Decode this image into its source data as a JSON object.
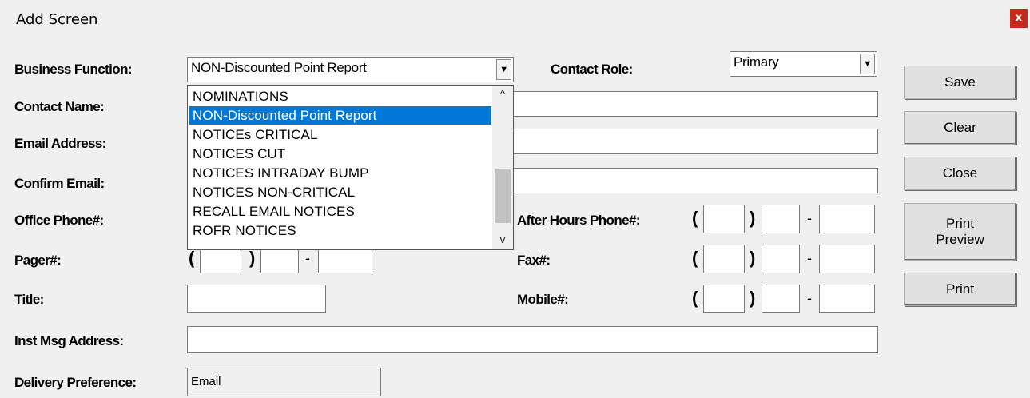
{
  "window": {
    "title": "Add Screen",
    "close_glyph": "x"
  },
  "labels": {
    "business_function": "Business Function:",
    "contact_name": "Contact Name:",
    "email_address": "Email Address:",
    "confirm_email": "Confirm Email:",
    "office_phone": "Office Phone#:",
    "pager": "Pager#:",
    "title": "Title:",
    "inst_msg": "Inst Msg Address:",
    "delivery_pref": "Delivery Preference:",
    "contact_role": "Contact Role:",
    "after_hours": "After Hours Phone#:",
    "fax": "Fax#:",
    "mobile": "Mobile#:"
  },
  "fields": {
    "business_function": "NON-Discounted Point Report",
    "contact_role": "Primary",
    "delivery_pref": "Email"
  },
  "dropdown": {
    "items": [
      "NOMINATIONS",
      "NON-Discounted Point Report",
      "NOTICEs CRITICAL",
      "NOTICES CUT",
      "NOTICES INTRADAY BUMP",
      "NOTICES NON-CRITICAL",
      "RECALL EMAIL NOTICES",
      "ROFR NOTICES"
    ],
    "selected": "NON-Discounted Point Report"
  },
  "phone_punct": {
    "open": "(",
    "close": ")",
    "dash": "-"
  },
  "buttons": {
    "save": "Save",
    "clear": "Clear",
    "close": "Close",
    "print_preview_1": "Print",
    "print_preview_2": "Preview",
    "print": "Print"
  },
  "icons": {
    "dropdown_arrow": "▼",
    "scroll_up": "^",
    "scroll_down": "v"
  }
}
